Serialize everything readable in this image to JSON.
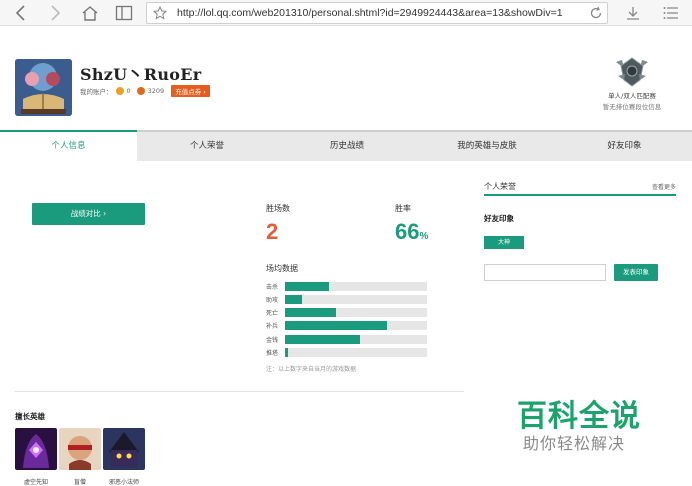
{
  "browser": {
    "url": "http://lol.qq.com/web201310/personal.shtml?id=2949924443&area=13&showDiv=1"
  },
  "profile": {
    "name": "ShzU丶RuoEr",
    "account_label": "我的账户：",
    "coin_gold": "0",
    "coin_points": "3209",
    "recharge_label": "充值点券 ›",
    "rank_title": "单人/双人匹配赛",
    "rank_sub": "暂无排位赛段位信息"
  },
  "tabs": [
    "个人信息",
    "个人荣誉",
    "历史战绩",
    "我的英雄与皮肤",
    "好友印象"
  ],
  "left": {
    "compare_label": "战绩对比 ›",
    "wins_label": "胜场数",
    "wins_value": "2",
    "winrate_label": "胜率",
    "winrate_value": "66",
    "winrate_unit": "%",
    "avg_title": "场均数据",
    "bars": [
      {
        "label": "击杀",
        "fill": 0.31
      },
      {
        "label": "助攻",
        "fill": 0.12
      },
      {
        "label": "死亡",
        "fill": 0.36
      },
      {
        "label": "补兵",
        "fill": 0.72
      },
      {
        "label": "金钱",
        "fill": 0.53
      },
      {
        "label": "推塔",
        "fill": 0.02
      }
    ],
    "note": "注：以上数字来自当月的游戏数据",
    "heroes_title": "擅长英雄",
    "heroes": [
      {
        "name": "虚空先知"
      },
      {
        "name": "盲僧"
      },
      {
        "name": "邪恶小法师"
      }
    ]
  },
  "right": {
    "honor_title": "个人荣誉",
    "honor_more": "查看更多",
    "impression_title": "好友印象",
    "tag": "大神",
    "input_value": "",
    "publish_label": "发表印象"
  },
  "watermark": {
    "big": "百科全说",
    "small": "助你轻松解决"
  },
  "colors": {
    "accent": "#1a9b7d",
    "wins": "#e25e37",
    "recharge": "#e85c1e"
  }
}
